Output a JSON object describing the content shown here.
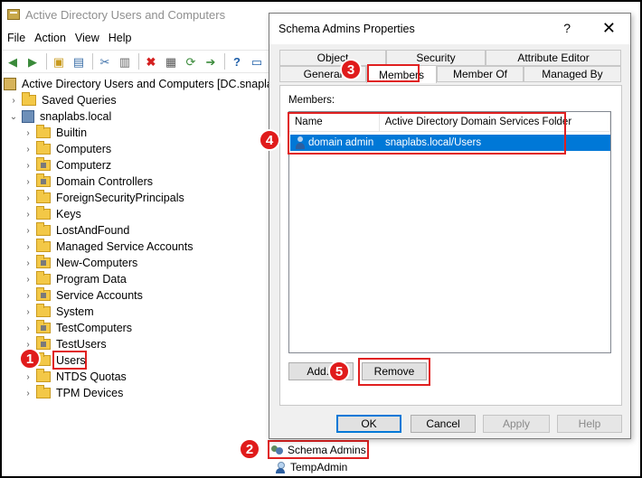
{
  "window": {
    "title": "Active Directory Users and Computers"
  },
  "menu": [
    "File",
    "Action",
    "View",
    "Help"
  ],
  "toolbar": {
    "buttons": [
      "back-arrow-icon",
      "forward-arrow-icon",
      "up-folder-icon",
      "show-pane-icon",
      "cut-icon",
      "clipboard-icon",
      "delete-icon",
      "properties-icon",
      "refresh-icon",
      "export-icon",
      "help-icon",
      "console-icon"
    ]
  },
  "tree": {
    "root": "Active Directory Users and Computers [DC.snaplab",
    "saved_queries": "Saved Queries",
    "domain": "snaplabs.local",
    "items": [
      "Builtin",
      "Computers",
      "Computerz",
      "Domain Controllers",
      "ForeignSecurityPrincipals",
      "Keys",
      "LostAndFound",
      "Managed Service Accounts",
      "New-Computers",
      "Program Data",
      "Service Accounts",
      "System",
      "TestComputers",
      "TestUsers",
      "Users",
      "NTDS Quotas",
      "TPM Devices"
    ]
  },
  "dialog": {
    "title": "Schema Admins Properties",
    "help": "?",
    "close": "✕",
    "tabs_top": [
      "Object",
      "Security",
      "Attribute Editor"
    ],
    "tabs_bottom": [
      "General",
      "Members",
      "Member Of",
      "Managed By"
    ],
    "active_tab": "Members",
    "members_label": "Members:",
    "columns": [
      "Name",
      "Active Directory Domain Services Folder"
    ],
    "rows": [
      {
        "name": "domain admin",
        "folder": "snaplabs.local/Users"
      }
    ],
    "add_button": "Add...",
    "remove_button": "Remove",
    "ok": "OK",
    "cancel": "Cancel",
    "apply": "Apply",
    "help_button": "Help"
  },
  "results": [
    "Schema Admins",
    "TempAdmin"
  ],
  "callouts": [
    "1",
    "2",
    "3",
    "4",
    "5"
  ],
  "colors": {
    "callout_red": "#e01b1b",
    "selection_blue": "#0078d7"
  }
}
